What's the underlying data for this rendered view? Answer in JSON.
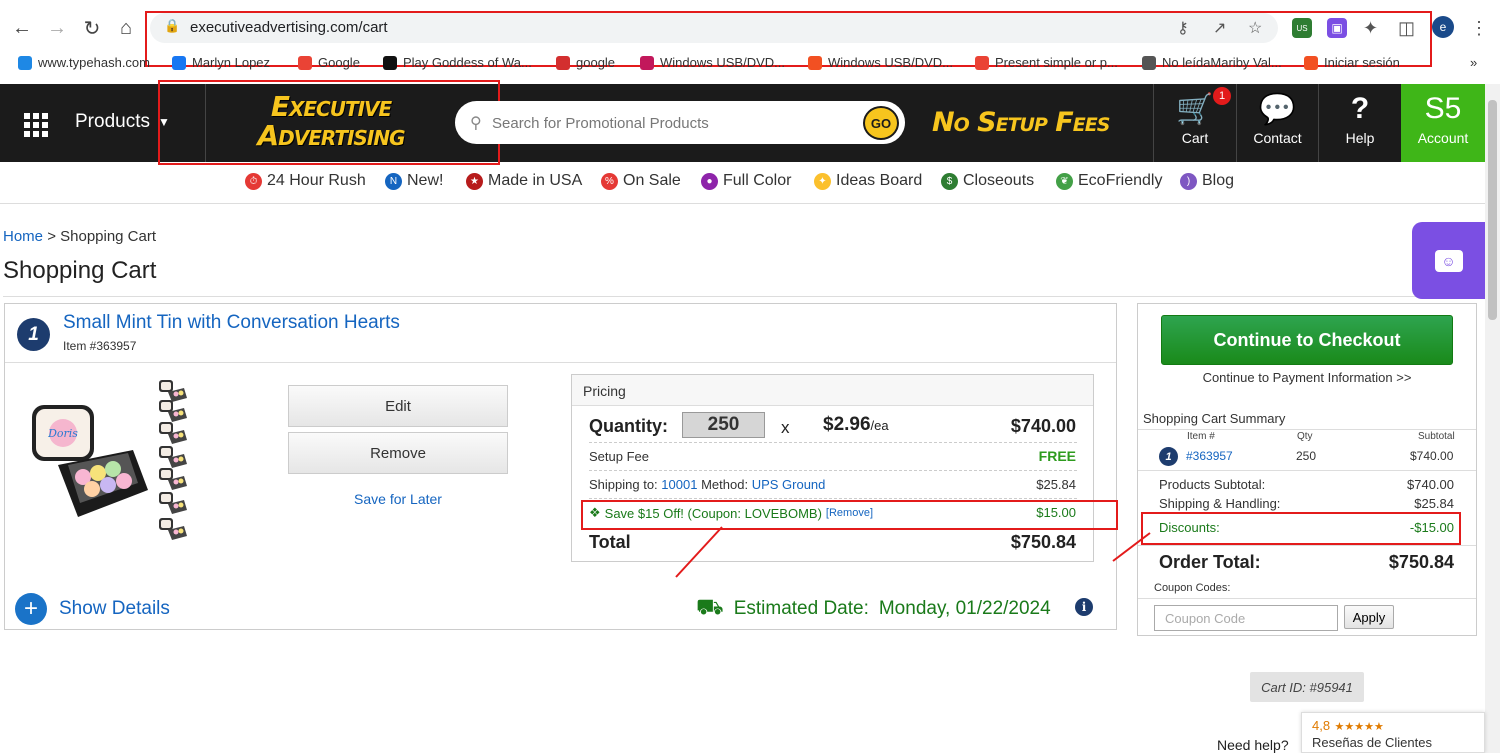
{
  "browser": {
    "url": "executiveadvertising.com/cart",
    "profile_initial": "e",
    "extension_badge": "US",
    "bookmarks": [
      {
        "label": "www.typehash.com",
        "color": "#1e88e5"
      },
      {
        "label": "Marlyn Lopez",
        "color": "#1877f2"
      },
      {
        "label": "Google",
        "color": "#ea4335"
      },
      {
        "label": "Play Goddess of Wa...",
        "color": "#111111"
      },
      {
        "label": "google",
        "color": "#d32f2f"
      },
      {
        "label": "Windows USB/DVD...",
        "color": "#c2185b"
      },
      {
        "label": "Windows USB/DVD...",
        "color": "#f25022"
      },
      {
        "label": "Present simple or p...",
        "color": "#ea4335"
      },
      {
        "label": "No leídaMariby Val...",
        "color": "#555555"
      },
      {
        "label": "Iniciar sesión",
        "color": "#f25022"
      }
    ],
    "more": "»"
  },
  "header": {
    "products_label": "Products",
    "logo_line1": "Executive",
    "logo_line2": "Advertising",
    "search_placeholder": "Search for Promotional Products",
    "go_label": "GO",
    "tagline": "No Setup Fees",
    "cart_label": "Cart",
    "cart_count": "1",
    "contact_label": "Contact",
    "help_label": "Help",
    "account_initials": "S5",
    "account_label": "Account",
    "accent_color": "#f7c51e",
    "account_color": "#3fb618"
  },
  "categories": [
    {
      "label": "24 Hour Rush",
      "icon": "stopwatch-icon",
      "color": "#e53935"
    },
    {
      "label": "New!",
      "icon": "new-badge-icon",
      "color": "#1565c0"
    },
    {
      "label": "Made in USA",
      "icon": "us-flag-icon",
      "color": "#b71c1c"
    },
    {
      "label": "On Sale",
      "icon": "sale-tag-icon",
      "color": "#e53935"
    },
    {
      "label": "Full Color",
      "icon": "color-wheel-icon",
      "color": "#8e24aa"
    },
    {
      "label": "Ideas Board",
      "icon": "lightbulb-icon",
      "color": "#fbc02d"
    },
    {
      "label": "Closeouts",
      "icon": "dollar-circle-icon",
      "color": "#2e7d32"
    },
    {
      "label": "EcoFriendly",
      "icon": "leaf-icon",
      "color": "#43a047"
    },
    {
      "label": "Blog",
      "icon": "wifi-feed-icon",
      "color": "#7e57c2"
    }
  ],
  "breadcrumb": {
    "home": "Home",
    "separator": ">",
    "current": "Shopping Cart"
  },
  "page_title": "Shopping Cart",
  "item": {
    "number": "1",
    "name": "Small Mint Tin with Conversation Hearts",
    "sku": "Item #363957",
    "edit_label": "Edit",
    "remove_label": "Remove",
    "save_later_label": "Save for Later",
    "pricing": {
      "header": "Pricing",
      "quantity_label": "Quantity:",
      "quantity": "250",
      "times": "x",
      "unit_price": "$2.96",
      "unit_suffix": "/ea",
      "line_total": "$740.00",
      "setup_label": "Setup Fee",
      "setup_value": "FREE",
      "shipping_prefix": "Shipping to:",
      "shipping_zip": "10001",
      "method_label": "Method:",
      "method": "UPS Ground",
      "shipping_value": "$25.84",
      "coupon_text": "Save $15 Off! (Coupon: LOVEBOMB)",
      "coupon_remove": "[Remove]",
      "coupon_value": "$15.00",
      "total_label": "Total",
      "total_value": "$750.84"
    },
    "show_details_label": "Show Details",
    "estimated_label": "Estimated Date:",
    "estimated_date": "Monday, 01/22/2024"
  },
  "summary": {
    "checkout_label": "Continue to Checkout",
    "checkout_sub": "Continue to Payment Information >>",
    "title": "Shopping Cart Summary",
    "col_item": "Item #",
    "col_qty": "Qty",
    "col_subtotal": "Subtotal",
    "row_num": "1",
    "row_item": "#363957",
    "row_qty": "250",
    "row_subtotal": "$740.00",
    "products_subtotal_label": "Products Subtotal:",
    "products_subtotal": "$740.00",
    "shipping_label": "Shipping & Handling:",
    "shipping": "$25.84",
    "discounts_label": "Discounts:",
    "discounts": "-$15.00",
    "order_total_label": "Order Total:",
    "order_total": "$750.84",
    "coupon_codes_label": "Coupon Codes:",
    "coupon_placeholder": "Coupon Code",
    "apply_label": "Apply"
  },
  "cart_id": "Cart ID: #95941",
  "need_help": "Need help?",
  "reviews": {
    "score": "4,8",
    "stars": "★★★★★",
    "label": "Reseñas de Clientes"
  }
}
